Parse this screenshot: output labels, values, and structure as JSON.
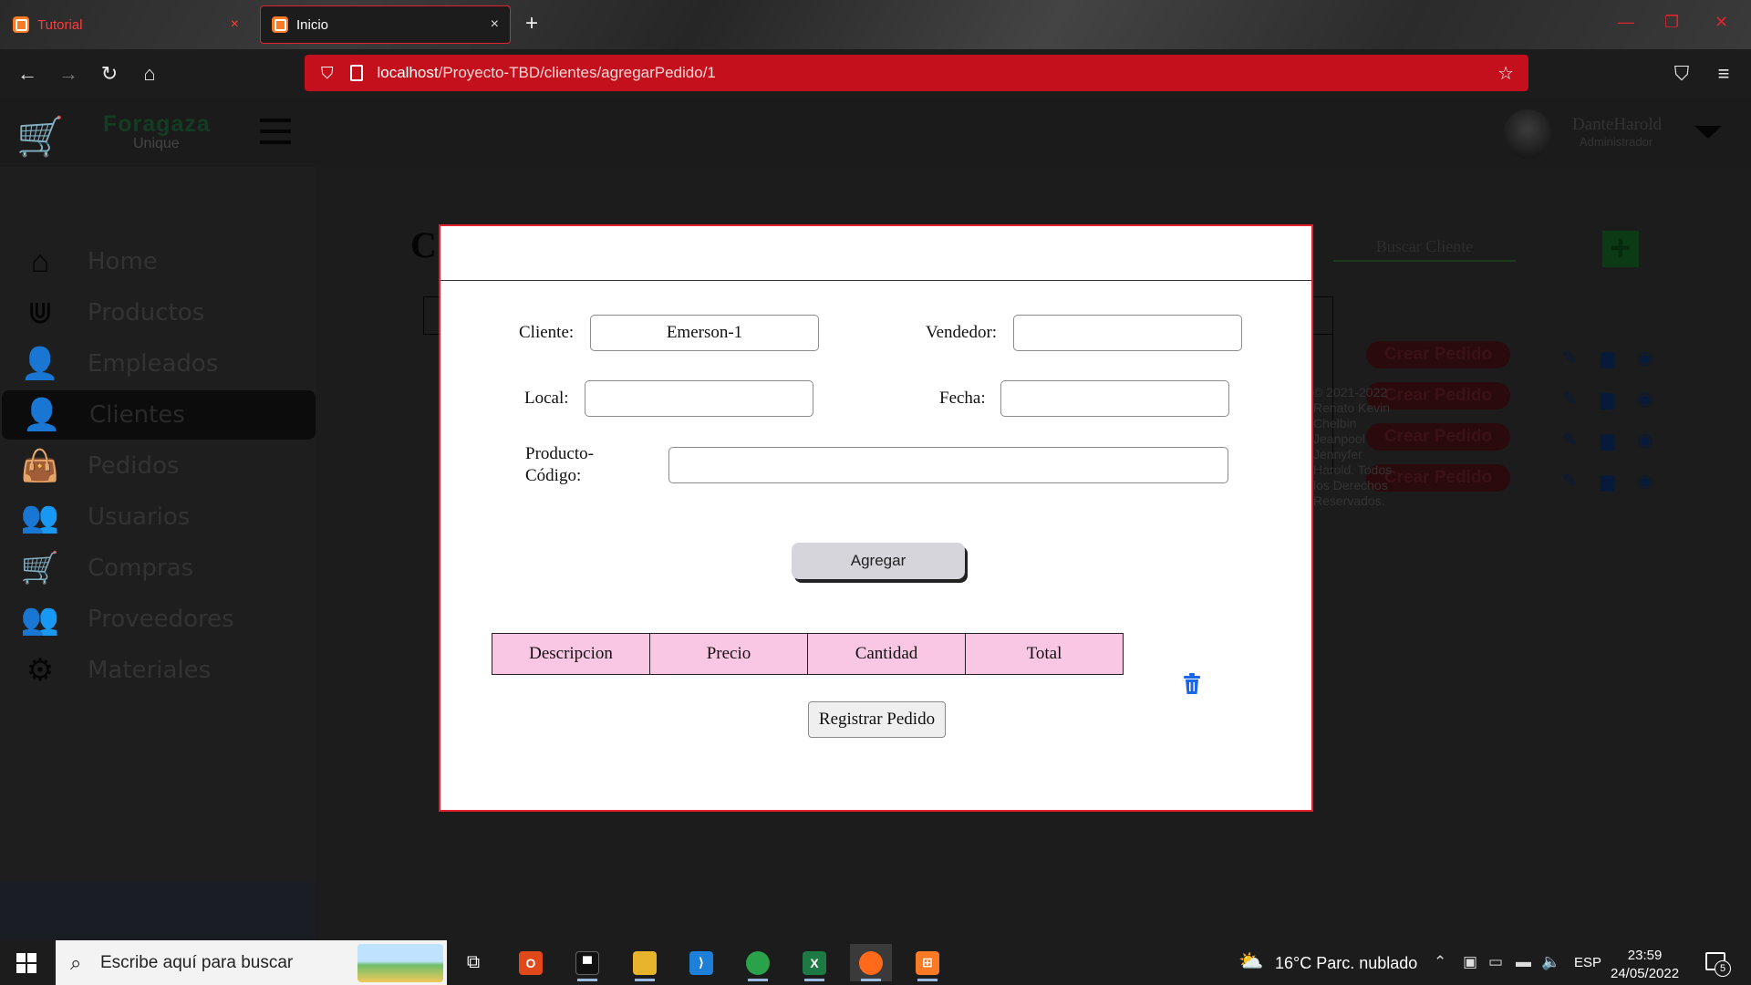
{
  "browser": {
    "tabs": [
      {
        "label": "Tutorial"
      },
      {
        "label": "Inicio"
      }
    ],
    "new_tab": "+",
    "close_glyph": "×",
    "url_host": "localhost",
    "url_path": "/Proyecto-TBD/clientes/agregarPedido/1"
  },
  "app": {
    "brand": "Foragaza",
    "brand_sub": "Unique",
    "user": {
      "name": "DanteHarold",
      "role": "Administrador"
    },
    "sidebar": [
      {
        "label": "Home",
        "icon": "home-icon"
      },
      {
        "label": "Productos",
        "icon": "hands-holding-icon"
      },
      {
        "label": "Empleados",
        "icon": "user-check-icon"
      },
      {
        "label": "Clientes",
        "icon": "user-icon"
      },
      {
        "label": "Pedidos",
        "icon": "shopping-bag-icon"
      },
      {
        "label": "Usuarios",
        "icon": "users-icon"
      },
      {
        "label": "Compras",
        "icon": "cart-icon"
      },
      {
        "label": "Proveedores",
        "icon": "user-group-icon"
      },
      {
        "label": "Materiales",
        "icon": "cogs-icon"
      }
    ],
    "active_item": "Clientes",
    "page_letter": "C",
    "search_placeholder": "Buscar Cliente",
    "crear_label": "Crear Pedido",
    "footer_text": "© 2021-2022 Renato Kevin Chelbin Jeanpool Jennyfer Harold. Todos los Derechos Reservados."
  },
  "modal": {
    "cliente_label": "Cliente:",
    "cliente_value": "Emerson-1",
    "vendedor_label": "Vendedor:",
    "vendedor_value": "",
    "local_label": "Local:",
    "local_value": "",
    "fecha_label": "Fecha:",
    "fecha_value": "",
    "producto_label_line1": "Producto-",
    "producto_label_line2": "Código:",
    "producto_value": "",
    "agregar_label": "Agregar",
    "table_headers": [
      "Descripcion",
      "Precio",
      "Cantidad",
      "Total"
    ],
    "registrar_label": "Registrar Pedido"
  },
  "taskbar": {
    "search_placeholder": "Escribe aquí para buscar",
    "weather": "16°C  Parc. nublado",
    "language": "ESP",
    "time": "23:59",
    "date": "24/05/2022",
    "notifications": "5"
  },
  "colors": {
    "url_bar": "#c4101d",
    "modal_border": "#e0242e",
    "table_header": "#f9c6e4",
    "trash_blue": "#1a66e6"
  }
}
